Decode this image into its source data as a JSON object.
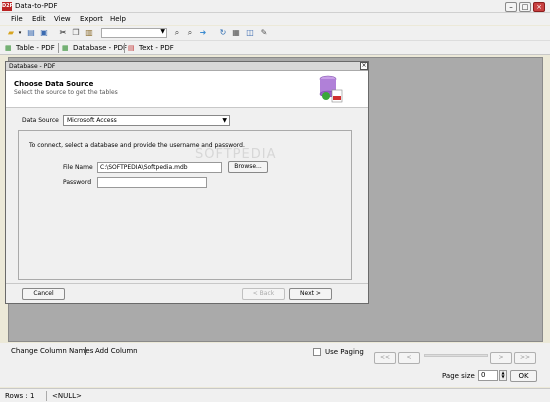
{
  "window": {
    "title": "Data-to-PDF",
    "app_icon_text": "D2P"
  },
  "menu": [
    "File",
    "Edit",
    "View",
    "Export",
    "Help"
  ],
  "toolbar_tabs": [
    "Table - PDF",
    "Database - PDF",
    "Text - PDF"
  ],
  "dialog": {
    "title": "Database - PDF",
    "heading": "Choose Data Source",
    "subheading": "Select the source to get the tables",
    "data_source_label": "Data Source",
    "data_source_value": "Microsoft Access",
    "instruction": "To connect, select a database and provide the username and password.",
    "file_name_label": "File Name",
    "file_name_value": "C:\\SOFTPEDIA\\Softpedia.mdb",
    "browse_label": "Browse...",
    "password_label": "Password",
    "password_value": "",
    "cancel_label": "Cancel",
    "back_label": "< Back",
    "next_label": "Next >"
  },
  "bottom": {
    "change_columns": "Change Column Names",
    "add_column": "Add Column",
    "use_paging": "Use Paging",
    "nav": [
      "<<",
      "<",
      ">",
      ">>"
    ],
    "page_size_label": "Page size",
    "page_size_value": "0",
    "ok_label": "OK"
  },
  "status": {
    "rows": "Rows : 1",
    "value": "<NULL>"
  },
  "watermark": "SOFTPEDIA"
}
